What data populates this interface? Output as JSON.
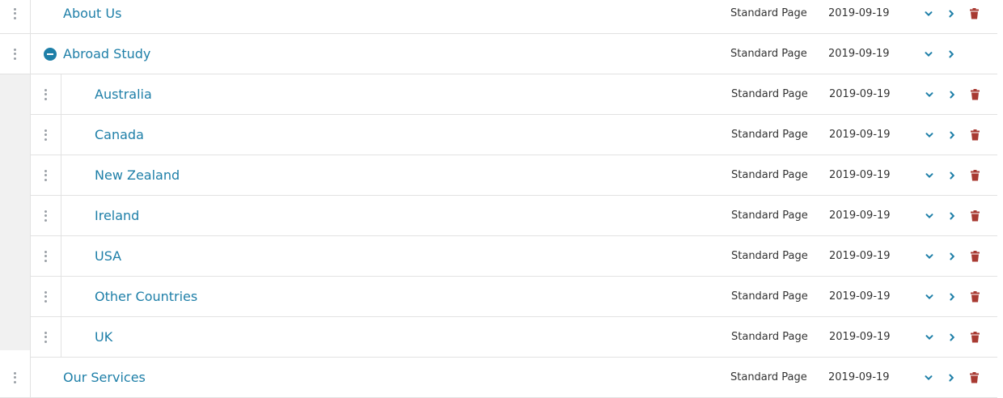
{
  "colors": {
    "link": "#1e7fa8",
    "action": "#1e7fa8",
    "delete": "#a83a32"
  },
  "icons": {
    "drag": "drag-handle-icon",
    "collapse": "minus-circle-icon",
    "expand_down": "chevron-down-icon",
    "open": "chevron-right-icon",
    "delete": "trash-icon"
  },
  "pages": [
    {
      "title": "About Us",
      "type": "Standard Page",
      "date": "2019-09-19",
      "level": 0,
      "deletable": true
    },
    {
      "title": "Abroad Study",
      "type": "Standard Page",
      "date": "2019-09-19",
      "level": 0,
      "deletable": false,
      "expanded": true,
      "children": [
        {
          "title": "Australia",
          "type": "Standard Page",
          "date": "2019-09-19",
          "deletable": true
        },
        {
          "title": "Canada",
          "type": "Standard Page",
          "date": "2019-09-19",
          "deletable": true
        },
        {
          "title": "New Zealand",
          "type": "Standard Page",
          "date": "2019-09-19",
          "deletable": true
        },
        {
          "title": "Ireland",
          "type": "Standard Page",
          "date": "2019-09-19",
          "deletable": true
        },
        {
          "title": "USA",
          "type": "Standard Page",
          "date": "2019-09-19",
          "deletable": true
        },
        {
          "title": "Other Countries",
          "type": "Standard Page",
          "date": "2019-09-19",
          "deletable": true
        },
        {
          "title": "UK",
          "type": "Standard Page",
          "date": "2019-09-19",
          "deletable": true
        }
      ]
    },
    {
      "title": "Our Services",
      "type": "Standard Page",
      "date": "2019-09-19",
      "level": 0,
      "deletable": true
    }
  ]
}
